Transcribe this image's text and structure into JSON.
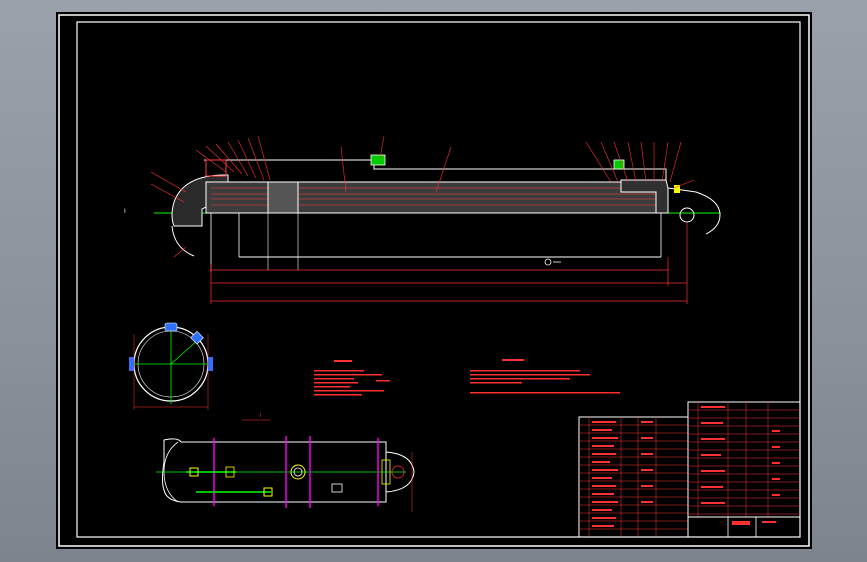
{
  "drawing": {
    "frame_color": "#ffffff",
    "colors": {
      "outline": "#ffffff",
      "centerline": "#00ff00",
      "leader": "#ff3030",
      "section": "#ff4040",
      "magenta": "#ff00ff",
      "yellow": "#ffff00",
      "cyan": "#00ccff",
      "blue": "#3070ff",
      "background": "#000000"
    },
    "section_marker": "I",
    "view_marker": "I",
    "icons": [
      "cylinder-main-view",
      "end-view",
      "top-view",
      "title-block",
      "parts-list"
    ]
  }
}
